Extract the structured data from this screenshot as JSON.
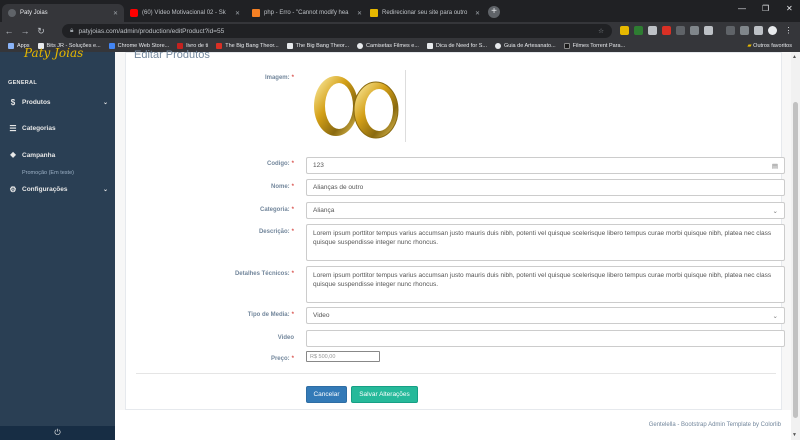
{
  "browser": {
    "tabs": [
      {
        "title": "Paty Joias",
        "fav_color": "#5f6368",
        "active": true
      },
      {
        "title": "(60) Vídeo Motivacional 02 - Sk",
        "fav_color": "#ff0000",
        "active": false
      },
      {
        "title": "php - Erro - \"Cannot modify hea",
        "fav_color": "#f48024",
        "active": false
      },
      {
        "title": "Redirecionar seu site para outro",
        "fav_color": "#e6b800",
        "active": false
      }
    ],
    "url": "patyjoias.com/admin/production/editProduct?id=55",
    "bookmarks": [
      {
        "label": "Apps",
        "color": "#8ab4f8"
      },
      {
        "label": "Bits JR - Soluções e...",
        "color": "#e8eaed"
      },
      {
        "label": "Chrome Web Store...",
        "color": "#4285f4"
      },
      {
        "label": "livro de ti",
        "color": "#c5221f"
      },
      {
        "label": "The Big Bang Theor...",
        "color": "#d93025"
      },
      {
        "label": "The Big Bang Theor...",
        "color": "#e8eaed"
      },
      {
        "label": "Camisetas Filmes e...",
        "color": "#e8eaed"
      },
      {
        "label": "Dica de Need for S...",
        "color": "#e8eaed"
      },
      {
        "label": "Guia de Artesanato...",
        "color": "#e8eaed"
      },
      {
        "label": "Filmes Torrent Para...",
        "color": "#1a1a1a"
      }
    ],
    "other_bookmarks": "Outros favoritos"
  },
  "sidebar": {
    "brand": "Paty Joias",
    "section": "GENERAL",
    "items": [
      {
        "label": "Produtos",
        "icon": "dollar-icon",
        "glyph": "$"
      },
      {
        "label": "Categorias",
        "icon": "list-icon",
        "glyph": "☰"
      },
      {
        "label": "Campanha",
        "icon": "tag-icon",
        "glyph": "⬥"
      },
      {
        "label": "Configurações",
        "icon": "gear-icon",
        "glyph": "⚙"
      }
    ],
    "sub_item": "Promoção (Em teste)"
  },
  "page": {
    "title": "Editar Produtos"
  },
  "form": {
    "imagem_label": "Imagem:",
    "codigo_label": "Codigo:",
    "codigo_value": "123",
    "nome_label": "Nome:",
    "nome_value": "Alianças de outro",
    "categoria_label": "Categoria:",
    "categoria_value": "Aliança",
    "descricao_label": "Descrição:",
    "descricao_value": "Lorem ipsum porttitor tempus varius accumsan justo mauris duis nibh, potenti vel quisque scelerisque libero tempus curae morbi quisque nibh, platea nec class quisque suspendisse integer nunc rhoncus.",
    "detalhes_label": "Detalhes Técnicos:",
    "detalhes_value": "Lorem ipsum porttitor tempus varius accumsan justo mauris duis nibh, potenti vel quisque scelerisque libero tempus curae morbi quisque nibh, platea nec class quisque suspendisse integer nunc rhoncus.",
    "tipo_label": "Tipo de Media:",
    "tipo_value": "Video",
    "video_label": "Video",
    "video_value": "",
    "preco_label": "Preço:",
    "preco_placeholder": "R$ 500,00",
    "required_mark": "*",
    "cancel_label": "Cancelar",
    "save_label": "Salvar Alterações"
  },
  "footer": {
    "text": "Gentelella - Bootstrap Admin Template by Colorlib"
  }
}
